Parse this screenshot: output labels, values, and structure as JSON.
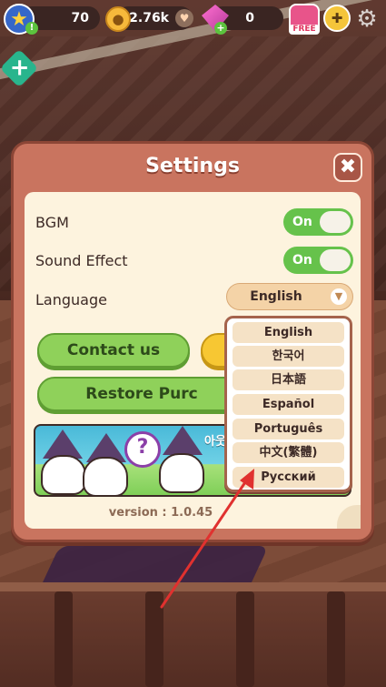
{
  "hud": {
    "star_count": "70",
    "star_badge": "!",
    "coin_count": "2.76k",
    "gem_count": "0",
    "free_label": "FREE",
    "icons": {
      "star": "star-icon",
      "coin": "paw-coin-icon",
      "heart": "heart-icon",
      "gem": "gem-icon",
      "free": "gift-icon",
      "game": "gamepad-icon",
      "settings": "gear-icon",
      "add": "plus-icon"
    }
  },
  "dialog": {
    "title": "Settings",
    "close_symbol": "✖",
    "bgm_label": "BGM",
    "bgm_state": "On",
    "sound_label": "Sound Effect",
    "sound_state": "On",
    "language_label": "Language",
    "language_value": "English",
    "contact_label": "Contact us",
    "restore_label": "Restore Purc",
    "banner_text": "아웃",
    "banner_qmark": "?",
    "version": "version : 1.0.45"
  },
  "language_options": [
    "English",
    "한국어",
    "日本語",
    "Español",
    "Português",
    "中文(繁體)",
    "Русский"
  ],
  "colors": {
    "toggle_on": "#66c24b",
    "button_green": "#8fd15a",
    "dialog_header": "#c9745f",
    "annotation_arrow": "#e0312f"
  }
}
